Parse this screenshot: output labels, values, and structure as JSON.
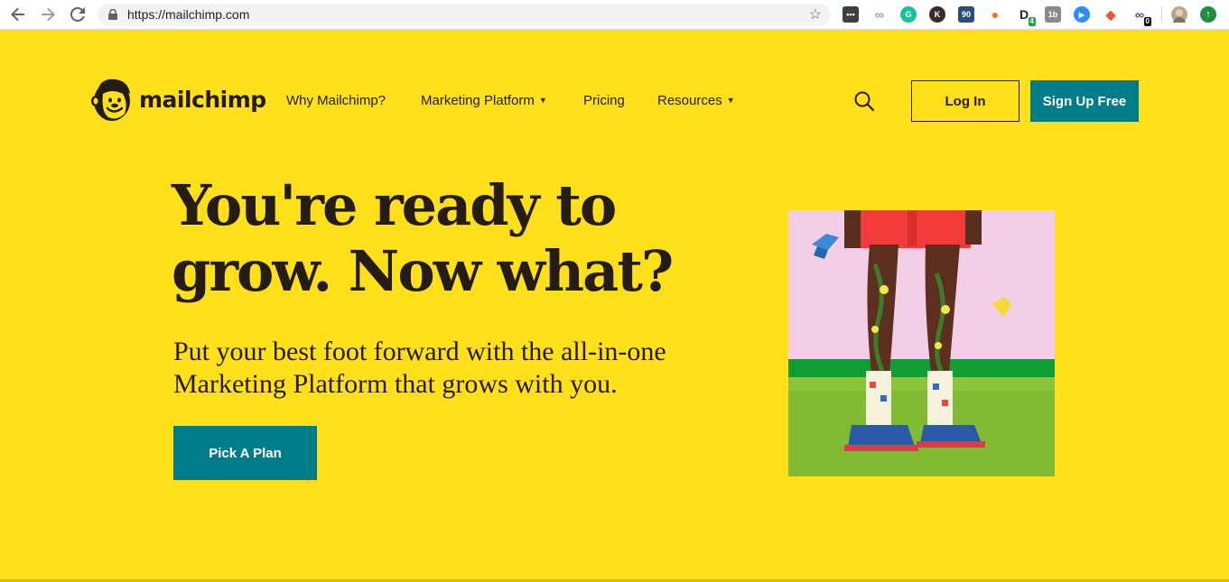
{
  "browser": {
    "url": "https://mailchimp.com",
    "back_icon": "arrow-left-icon",
    "forward_icon": "arrow-right-icon",
    "reload_icon": "reload-icon",
    "bookmark_icon": "star-icon",
    "extensions": [
      {
        "name": "dots-extension",
        "label": "•••",
        "badge": "",
        "color": "#3c4043"
      },
      {
        "name": "link-extension",
        "label": "∞",
        "badge": "",
        "color": "#7aa6d9"
      },
      {
        "name": "grammarly-extension",
        "label": "G",
        "badge": "",
        "color": "#15c39a"
      },
      {
        "name": "k-extension",
        "label": "K",
        "badge": "",
        "color": "#3b2a2a"
      },
      {
        "name": "ninety-extension",
        "label": "90",
        "badge": "",
        "color": "#2b4d7a"
      },
      {
        "name": "reddit-extension",
        "label": "●",
        "badge": "",
        "color": "#ff6b1a"
      },
      {
        "name": "d-extension",
        "label": "D",
        "badge": "4",
        "color": "#222222"
      },
      {
        "name": "onetab-extension",
        "label": "1b",
        "badge": "",
        "color": "#8a8a8a"
      },
      {
        "name": "zoom-extension",
        "label": "▶",
        "badge": "",
        "color": "#2d8cff"
      },
      {
        "name": "fox-extension",
        "label": "◆",
        "badge": "",
        "color": "#f0522d"
      },
      {
        "name": "chain-extension",
        "label": "∞",
        "badge": "0",
        "color": "#3949ab"
      }
    ],
    "update_icon": "arrow-up-circle-icon"
  },
  "header": {
    "brand": "mailchimp",
    "nav": [
      {
        "label": "Why Mailchimp?",
        "has_dropdown": false
      },
      {
        "label": "Marketing Platform",
        "has_dropdown": true
      },
      {
        "label": "Pricing",
        "has_dropdown": false
      },
      {
        "label": "Resources",
        "has_dropdown": true
      }
    ],
    "search_icon": "search-icon",
    "login_label": "Log In",
    "signup_label": "Sign Up Free"
  },
  "hero": {
    "headline": "You're ready to grow. Now what?",
    "subhead": "Put your best foot forward with the all-in-one Marketing Platform that grows with you.",
    "cta_label": "Pick A Plan"
  },
  "colors": {
    "page_bg": "#ffe01b",
    "teal": "#007c89",
    "text": "#241c15"
  }
}
